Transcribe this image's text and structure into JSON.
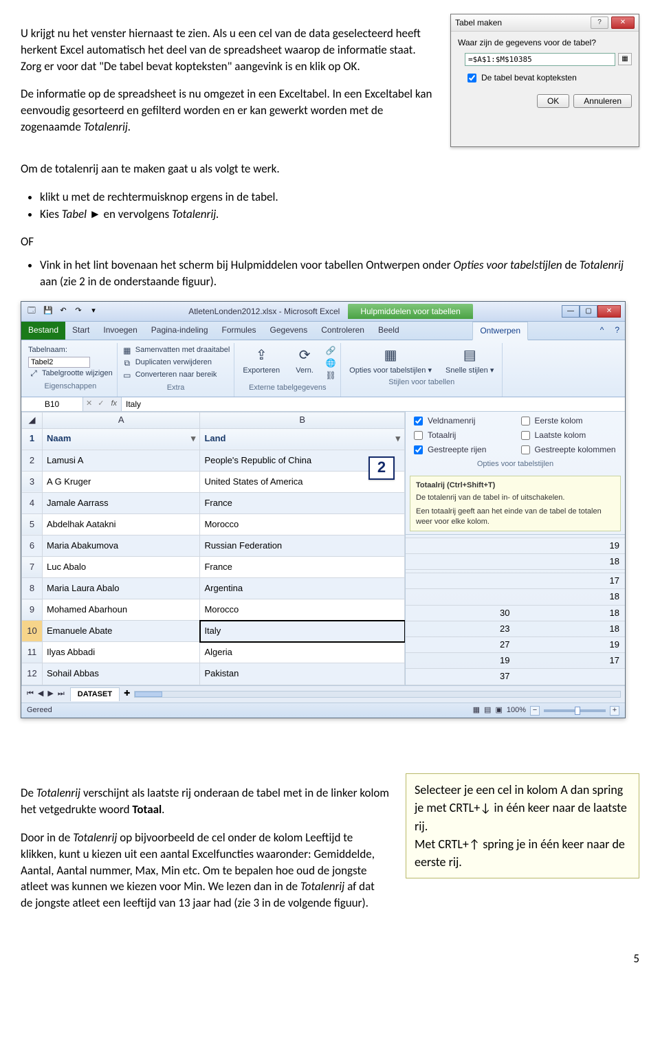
{
  "body": {
    "p1": "U krijgt nu het venster hiernaast te zien. Als u een cel van de data geselecteerd heeft herkent Excel automatisch het deel van de spreadsheet waarop de informatie staat. Zorg er voor dat \"De tabel bevat kopteksten\" aangevink is en klik op OK.",
    "p2a": "De informatie op de spreadsheet is nu omgezet in een Exceltabel. In een Exceltabel kan eenvoudig gesorteerd en gefilterd worden en er kan gewerkt worden met de zogenaamde ",
    "p2b": "Totalenrij.",
    "p3": "Om de totalenrij aan te maken gaat u als volgt te werk.",
    "li1": "klikt u met de rechtermuisknop ergens in de tabel.",
    "li2a": "Kies ",
    "li2b": "Tabel",
    "li2c": " ► en vervolgens ",
    "li2d": "Totalenrij.",
    "of": "OF",
    "li3a": "Vink in het lint bovenaan het scherm bij Hulpmiddelen voor tabellen Ontwerpen onder ",
    "li3b": "Opties voor tabelstijlen",
    "li3c": " de ",
    "li3d": "Totalenrij",
    "li3e": " aan (zie 2 in de onderstaande figuur).",
    "p4a": "De ",
    "p4b": "Totalenrij",
    "p4c": " verschijnt als laatste rij onderaan de tabel met in de linker kolom het vetgedrukte woord ",
    "p4d": "Totaal",
    "p4e": ".",
    "p5a": "Door in de ",
    "p5b": "Totalenrij",
    "p5c": " op bijvoorbeeld de cel onder de kolom Leeftijd te klikken, kunt u kiezen uit een aantal Excelfuncties waaronder: Gemiddelde, Aantal, Aantal nummer, Max, Min etc. Om te bepalen hoe oud de jongste atleet was kunnen we kiezen voor Min. We lezen dan in de ",
    "p5d": "Totalenrij",
    "p5e": " af dat de jongste atleet een leeftijd van 13 jaar had (zie 3 in de volgende figuur).",
    "tip1": "Selecteer je een cel in kolom A dan spring je met CRTL+↓ in één keer naar de laatste rij.",
    "tip2": "Met CRTL+↑ spring je in één keer naar de eerste rij.",
    "pagenum": "5"
  },
  "dialog": {
    "title": "Tabel maken",
    "question": "Waar zijn de gegevens voor de tabel?",
    "range": "=$A$1:$M$10385",
    "checkbox": "De tabel bevat kopteksten",
    "ok": "OK",
    "cancel": "Annuleren"
  },
  "excel": {
    "title": "AtletenLonden2012.xlsx - Microsoft Excel",
    "tools_title": "Hulpmiddelen voor tabellen",
    "tabs": {
      "file": "Bestand",
      "start": "Start",
      "invoegen": "Invoegen",
      "pagina": "Pagina-indeling",
      "formules": "Formules",
      "gegevens": "Gegevens",
      "controleren": "Controleren",
      "beeld": "Beeld",
      "ontwerpen": "Ontwerpen"
    },
    "ribbon": {
      "tablename_label": "Tabelnaam:",
      "tablename_value": "Tabel2",
      "resize": "Tabelgrootte wijzigen",
      "group1": "Eigenschappen",
      "pivot": "Samenvatten met draaitabel",
      "dedup": "Duplicaten verwijderen",
      "convert": "Converteren naar bereik",
      "group2": "Extra",
      "export": "Exporteren",
      "refresh": "Vern.",
      "group3": "Externe tabelgegevens",
      "opties": "Opties voor tabelstijlen ▾",
      "snelle": "Snelle stijlen ▾",
      "group4": "Stijlen voor tabellen"
    },
    "namebox": "B10",
    "fx": "Italy",
    "callout2": "2",
    "cols": {
      "A": "A",
      "B": "B"
    },
    "hdr": {
      "naam": "Naam",
      "land": "Land"
    },
    "rows": [
      {
        "n": "2",
        "a": "Lamusi A",
        "b": "People's Republic of China",
        "c": "",
        "d": ""
      },
      {
        "n": "3",
        "a": "A G Kruger",
        "b": "United States of America",
        "c": "",
        "d": "19"
      },
      {
        "n": "4",
        "a": "Jamale Aarrass",
        "b": "France",
        "c": "",
        "d": "18"
      },
      {
        "n": "5",
        "a": "Abdelhak Aatakni",
        "b": "Morocco",
        "c": "",
        "d": ""
      },
      {
        "n": "6",
        "a": "Maria Abakumova",
        "b": "Russian Federation",
        "c": "",
        "d": "17"
      },
      {
        "n": "7",
        "a": "Luc Abalo",
        "b": "France",
        "c": "",
        "d": "18"
      },
      {
        "n": "8",
        "a": "Maria Laura Abalo",
        "b": "Argentina",
        "c": "30",
        "d": "18"
      },
      {
        "n": "9",
        "a": "Mohamed Abarhoun",
        "b": "Morocco",
        "c": "23",
        "d": "18"
      },
      {
        "n": "10",
        "a": "Emanuele Abate",
        "b": "Italy",
        "c": "27",
        "d": "19"
      },
      {
        "n": "11",
        "a": "Ilyas Abbadi",
        "b": "Algeria",
        "c": "19",
        "d": "17"
      },
      {
        "n": "12",
        "a": "Sohail Abbas",
        "b": "Pakistan",
        "c": "37",
        "d": ""
      }
    ],
    "options": {
      "veldnamen": "Veldnamenrij",
      "eerste": "Eerste kolom",
      "totaal": "Totaalrij",
      "laatste": "Laatste kolom",
      "gestreepte_r": "Gestreepte rijen",
      "gestreepte_k": "Gestreepte kolommen",
      "sub": "Opties voor tabelstijlen"
    },
    "tooltip": {
      "title": "Totaalrij (Ctrl+Shift+T)",
      "line1": "De totalenrij van de tabel in- of uitschakelen.",
      "line2": "Een totaalrij geeft aan het einde van de tabel de totalen weer voor elke kolom."
    },
    "sheet": "DATASET",
    "status": "Gereed",
    "zoom": "100%"
  }
}
